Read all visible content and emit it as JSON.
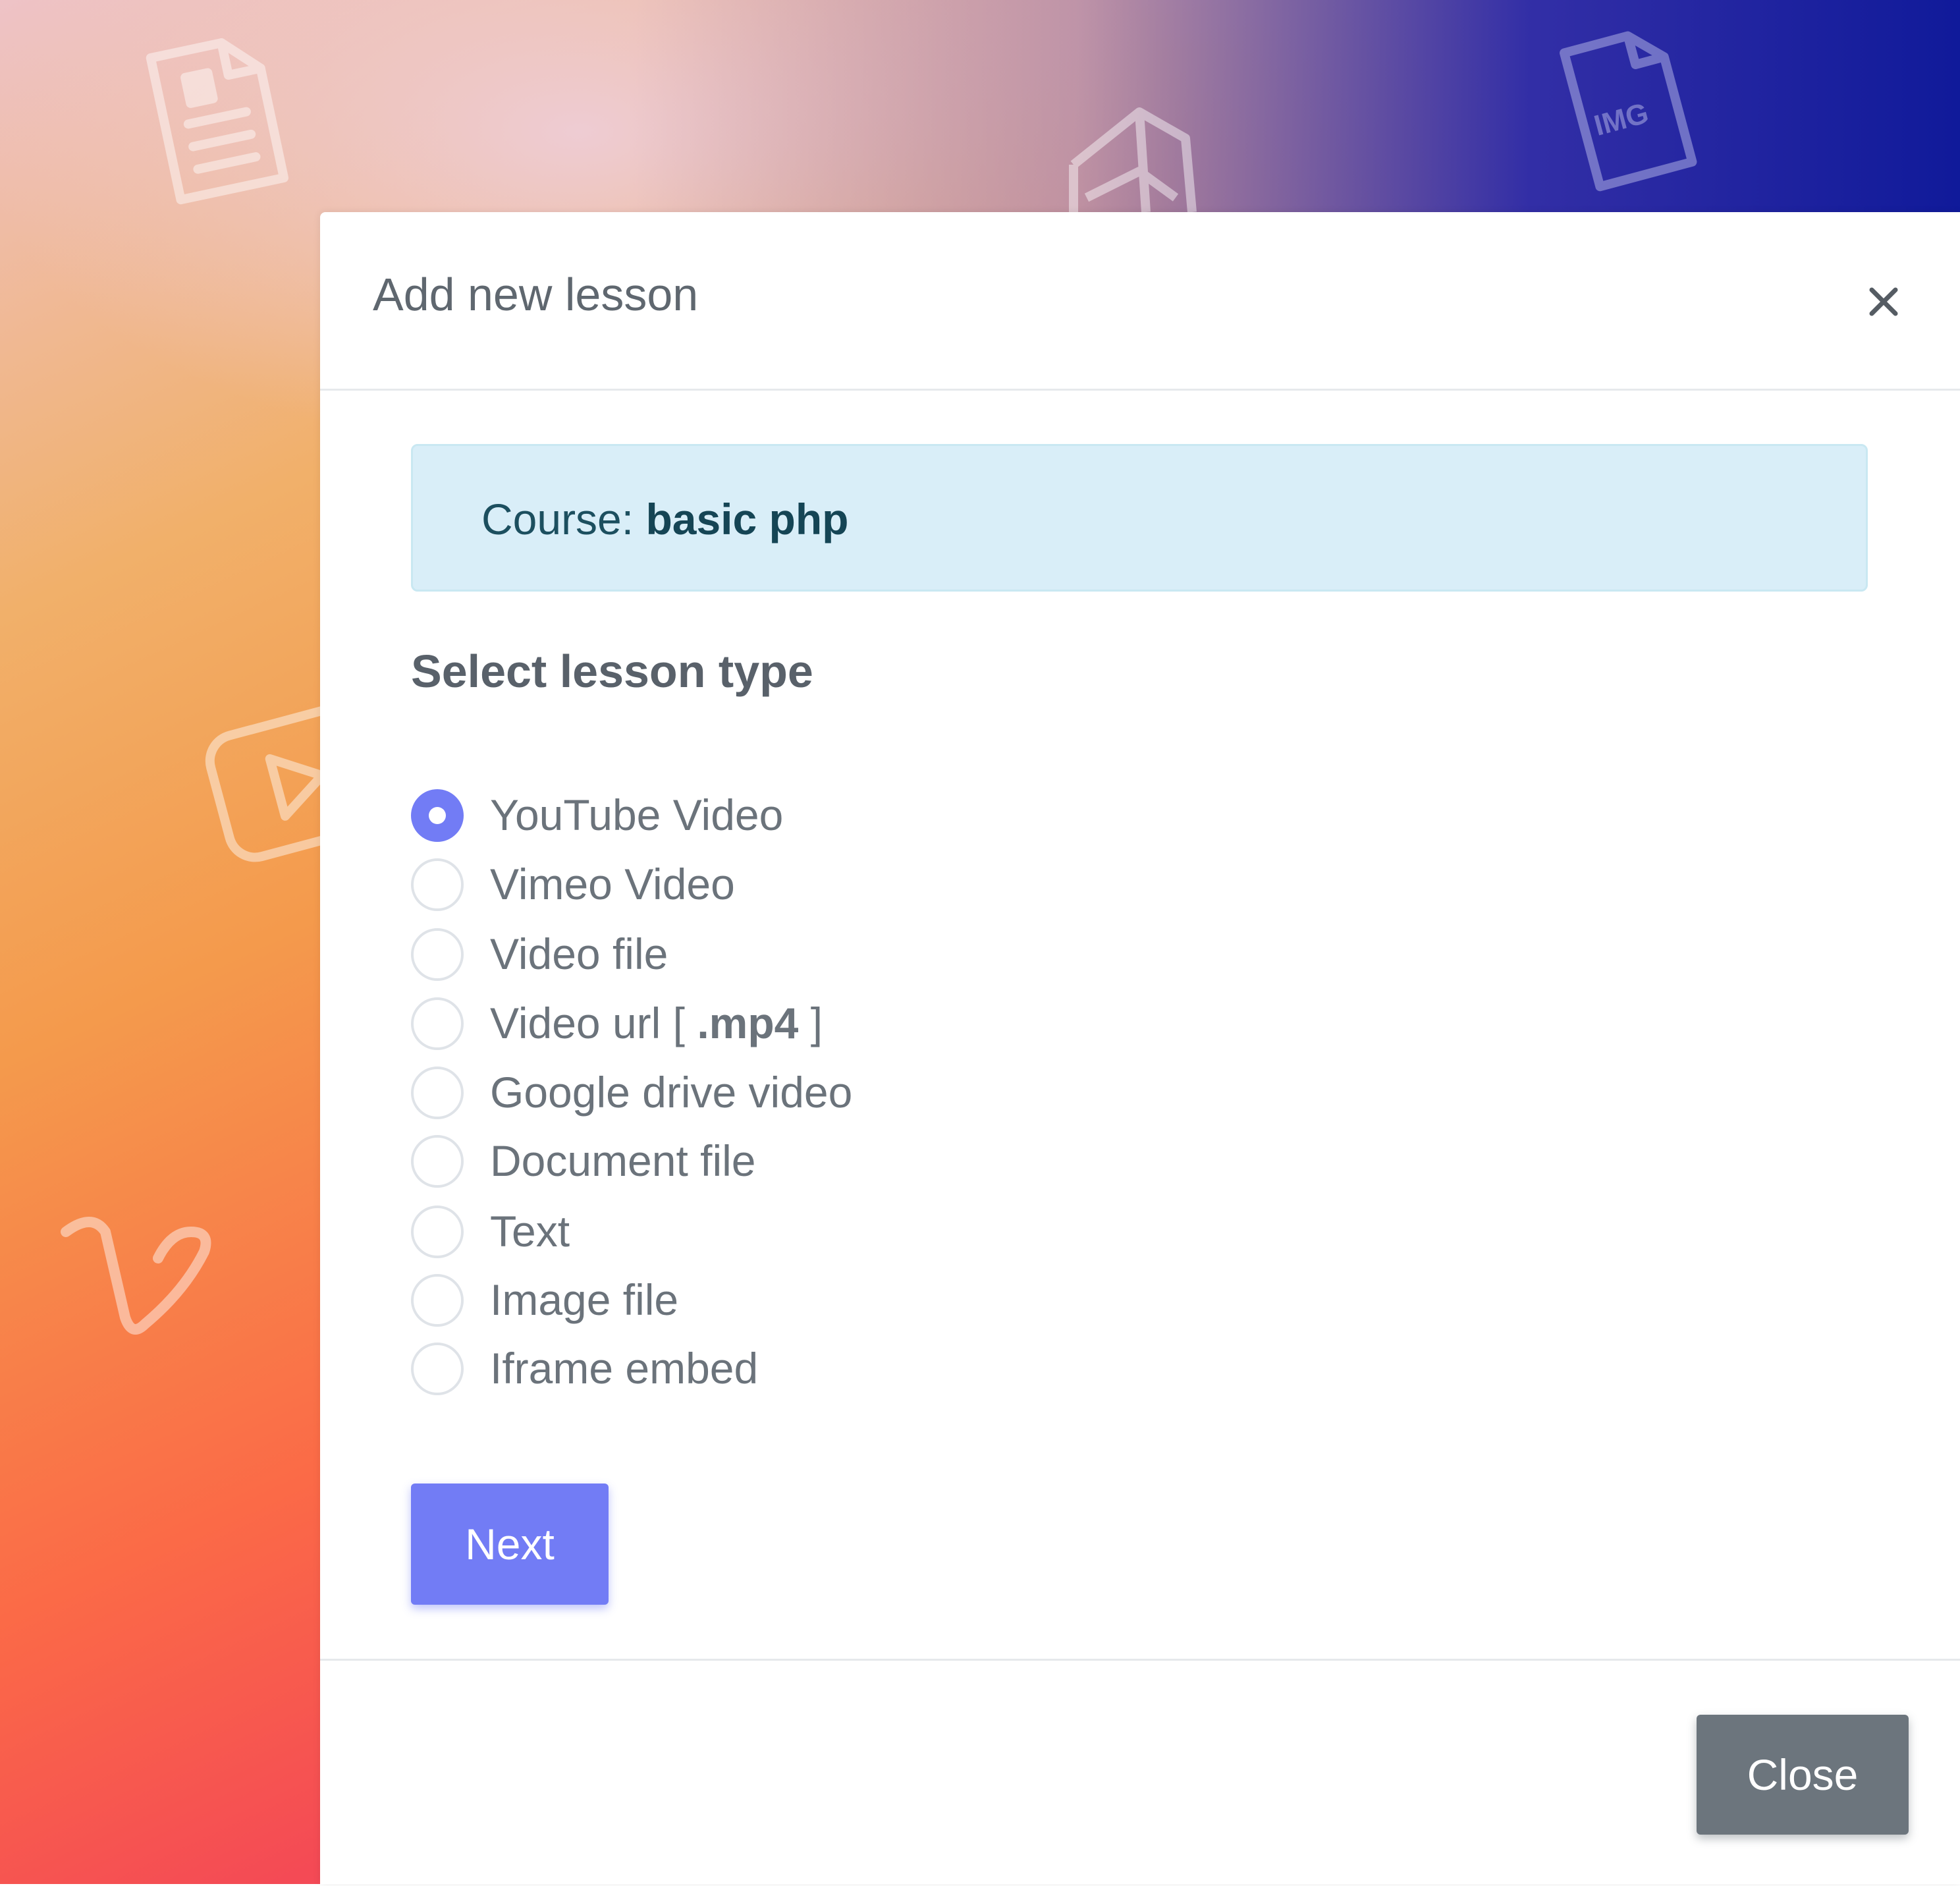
{
  "background": {
    "colors": {
      "gradient_warm": [
        "#eec3c7",
        "#f1b06a",
        "#fb6a47",
        "#d63a75"
      ],
      "gradient_cool": "#101a9a"
    },
    "icons": [
      "document-icon",
      "image-file-icon",
      "cube-icon",
      "video-play-icon",
      "vimeo-icon"
    ],
    "img_icon_text": "IMG"
  },
  "modal": {
    "title": "Add new lesson",
    "close_icon": "close-icon",
    "course_prefix": "Course: ",
    "course_name": "basic php",
    "section_label": "Select lesson type",
    "lesson_types": [
      {
        "label": "YouTube Video",
        "checked": true
      },
      {
        "label": "Vimeo Video",
        "checked": false
      },
      {
        "label": "Video file",
        "checked": false
      },
      {
        "label": "Video url [ ",
        "label_bold": ".mp4",
        "label_suffix": " ]",
        "checked": false
      },
      {
        "label": "Google drive video",
        "checked": false
      },
      {
        "label": "Document file",
        "checked": false
      },
      {
        "label": "Text",
        "checked": false
      },
      {
        "label": "Image file",
        "checked": false
      },
      {
        "label": "Iframe embed",
        "checked": false
      }
    ],
    "next_label": "Next",
    "close_label": "Close",
    "colors": {
      "primary": "#727cf5",
      "secondary": "#6c757d",
      "info_bg": "#d9eef8",
      "info_text": "#1c4f5f"
    }
  }
}
